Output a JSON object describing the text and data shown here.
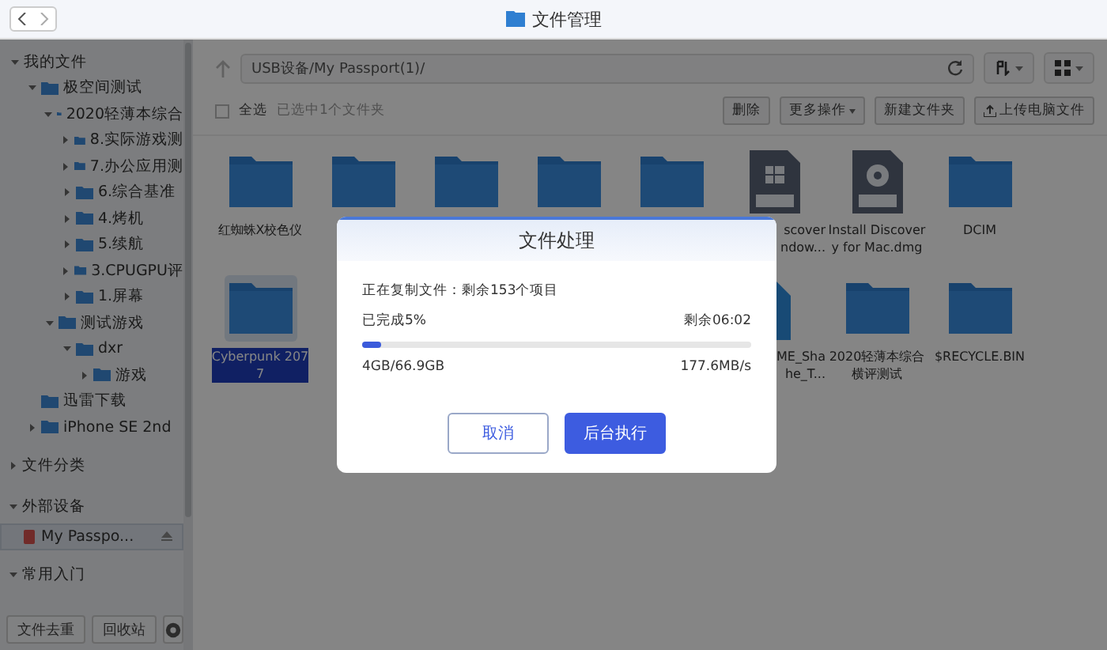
{
  "window": {
    "title": "文件管理"
  },
  "sidebar": {
    "tree": [
      {
        "label": "我的文件",
        "expanded": true,
        "children": [
          {
            "label": "极空间测试",
            "expanded": true,
            "children": [
              {
                "label": "2020轻薄本综合",
                "expanded": true,
                "children": [
                  {
                    "label": "8.实际游戏测",
                    "expanded": false
                  },
                  {
                    "label": "7.办公应用测",
                    "expanded": false
                  },
                  {
                    "label": "6.综合基准",
                    "expanded": false
                  },
                  {
                    "label": "4.烤机",
                    "expanded": false
                  },
                  {
                    "label": "5.续航",
                    "expanded": false
                  },
                  {
                    "label": "3.CPUGPU评",
                    "expanded": false
                  },
                  {
                    "label": "1.屏幕",
                    "expanded": false
                  }
                ]
              },
              {
                "label": "测试游戏",
                "expanded": true,
                "children": [
                  {
                    "label": "dxr",
                    "expanded": true,
                    "children": [
                      {
                        "label": "游戏",
                        "expanded": false
                      }
                    ]
                  }
                ]
              }
            ]
          },
          {
            "label": "迅雷下载"
          },
          {
            "label": "iPhone SE 2nd",
            "expanded": false
          }
        ]
      }
    ],
    "sections": [
      {
        "label": "文件分类",
        "expanded": false
      },
      {
        "label": "外部设备",
        "expanded": true,
        "items": [
          {
            "label": "My Passpo...",
            "selected": true
          }
        ]
      },
      {
        "label": "常用入门",
        "expanded": true
      }
    ],
    "footer_buttons": [
      "文件去重",
      "回收站"
    ]
  },
  "toolbar": {
    "path": "USB设备/My Passport(1)/"
  },
  "actions": {
    "select_all": {
      "label": "全选",
      "checked": false
    },
    "selection_info": "已选中1个文件夹",
    "buttons": [
      {
        "label": "删除",
        "kind": "plain"
      },
      {
        "label": "更多操作",
        "kind": "dropdown"
      },
      {
        "label": "新建文件夹",
        "kind": "plain"
      },
      {
        "label": "上传电脑文件",
        "kind": "upload"
      }
    ]
  },
  "files": [
    {
      "kind": "folder",
      "label": [
        "红蜘蛛X校色仪"
      ],
      "selected": false
    },
    {
      "kind": "folder",
      "selected": false
    },
    {
      "kind": "folder",
      "selected": false
    },
    {
      "kind": "folder",
      "selected": false
    },
    {
      "kind": "folder",
      "selected": false
    },
    {
      "kind": "exe",
      "label": [
        "scover",
        "ndow..."
      ],
      "cut": true,
      "selected": false
    },
    {
      "kind": "dmg",
      "label": [
        "Install Discover",
        "y for Mac.dmg"
      ],
      "selected": false
    },
    {
      "kind": "folder",
      "label": [
        "DCIM"
      ],
      "selected": false
    },
    {
      "kind": "folder",
      "label": [
        "Cyberpunk 207",
        "7"
      ],
      "selected": true
    },
    {
      "kind": "empty"
    },
    {
      "kind": "empty"
    },
    {
      "kind": "empty"
    },
    {
      "kind": "empty"
    },
    {
      "kind": "file",
      "label": [
        "ME_Sha",
        "he_T..."
      ],
      "cut": true,
      "selected": false
    },
    {
      "kind": "folder",
      "label": [
        "2020轻薄本综合",
        "横评测试"
      ],
      "selected": false
    },
    {
      "kind": "folder",
      "label": [
        "$RECYCLE.BIN"
      ],
      "selected": false
    }
  ],
  "dialog": {
    "title": "文件处理",
    "status": "正在复制文件：剩余153个项目",
    "progress_label": "已完成5%",
    "remaining": "剩余06:02",
    "level": 0.05,
    "size": "4GB/66.9GB",
    "speed": "177.6MB/s",
    "buttons": [
      {
        "label": "取消",
        "kind": "secondary"
      },
      {
        "label": "后台执行",
        "kind": "primary"
      }
    ]
  }
}
